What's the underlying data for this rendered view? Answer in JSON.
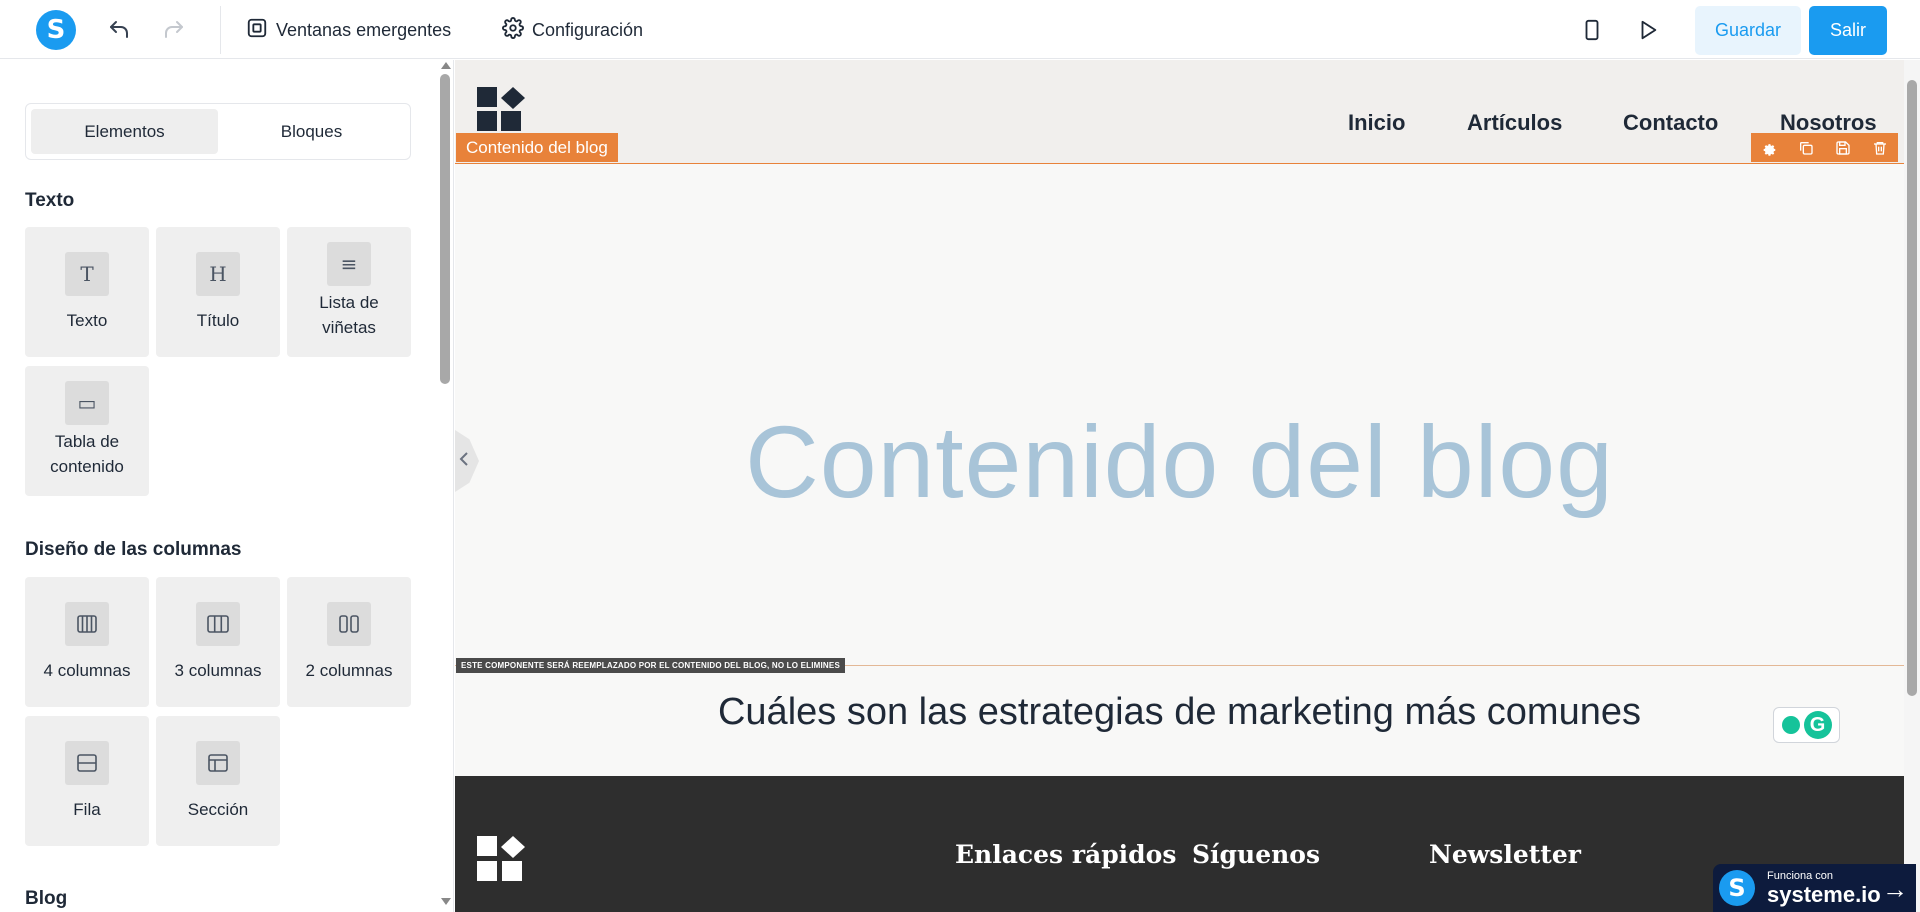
{
  "topbar": {
    "logo_letter": "S",
    "popups_label": "Ventanas emergentes",
    "settings_label": "Configuración",
    "save_label": "Guardar",
    "exit_label": "Salir"
  },
  "sidebar": {
    "tabs": [
      "Elementos",
      "Bloques"
    ],
    "sections": {
      "text": {
        "title": "Texto",
        "items": [
          {
            "label": "Texto",
            "glyph": "T"
          },
          {
            "label": "Título",
            "glyph": "H"
          },
          {
            "label": "Lista de viñetas",
            "glyph": "≡"
          },
          {
            "label": "Tabla de contenido",
            "glyph": "▭"
          }
        ]
      },
      "columns": {
        "title": "Diseño de las columnas",
        "items": [
          {
            "label": "4 columnas"
          },
          {
            "label": "3 columnas"
          },
          {
            "label": "2 columnas"
          },
          {
            "label": "Fila"
          },
          {
            "label": "Sección"
          }
        ]
      },
      "blog": {
        "title": "Blog"
      }
    }
  },
  "canvas": {
    "nav": [
      "Inicio",
      "Artículos",
      "Contacto",
      "Nosotros"
    ],
    "blog_label": "Contenido del blog",
    "hero_text": "Contenido del blog",
    "note": "ESTE COMPONENTE SERÁ REEMPLAZADO POR EL CONTENIDO DEL BLOG, NO LO ELIMINES",
    "article_title": "Cuáles son las estrategias de marketing más comunes",
    "grammarly_letter": "G",
    "footer": {
      "headings": [
        "Enlaces rápidos",
        "Síguenos",
        "Newsletter"
      ]
    }
  },
  "badge": {
    "small": "Funciona con",
    "big": "systeme.io",
    "letter": "S"
  },
  "colors": {
    "accent": "#1a9bf0",
    "orange": "#e8823a",
    "hero_text": "#a8c4d8",
    "footer_bg": "#2e2e2e"
  }
}
